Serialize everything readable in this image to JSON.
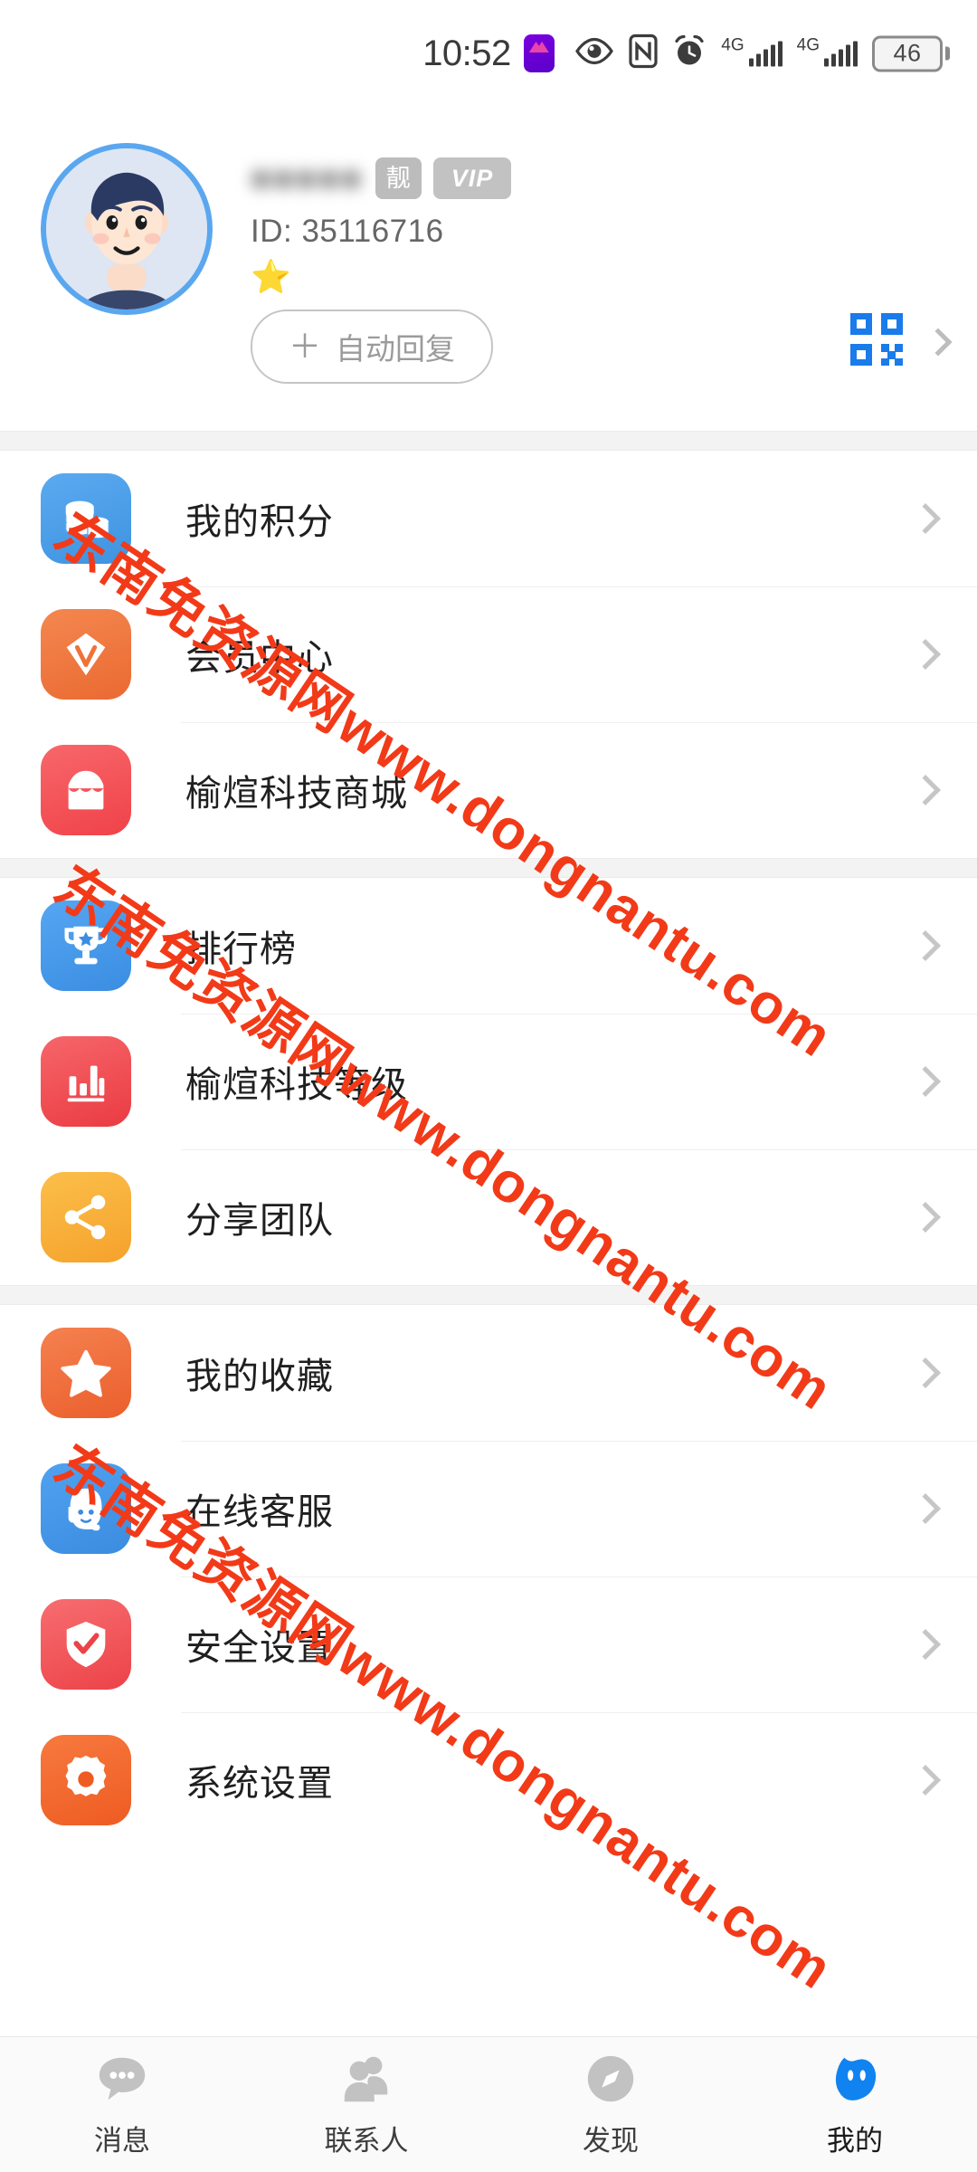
{
  "statusbar": {
    "time": "10:52",
    "app_icon": "app-notification-icon",
    "icons": [
      "eye-icon",
      "nfc-icon",
      "alarm-clock-icon"
    ],
    "signal_1_label": "4G",
    "signal_2_label": "4G",
    "battery_level": "46"
  },
  "profile": {
    "avatar": "user-avatar-cartoon",
    "nickname": "●●●●●",
    "badge_liang": "靓",
    "badge_vip": "VIP",
    "id_label": "ID: 35116716",
    "level_star": "⭐",
    "auto_reply_plus": "＋",
    "auto_reply_label": "自动回复",
    "qr_icon": "qr-code-icon",
    "chevron": "chevron-right-icon"
  },
  "menu_groups": [
    {
      "items": [
        {
          "label": "我的积分",
          "icon": "coins-icon",
          "color_start": "#5aaaf0",
          "color_end": "#3f93e0"
        },
        {
          "label": "会员中心",
          "icon": "diamond-icon",
          "color_start": "#f4874f",
          "color_end": "#ea6a32"
        },
        {
          "label": "榆煊科技商城",
          "icon": "shop-icon",
          "color_start": "#f8676b",
          "color_end": "#ef4248"
        }
      ]
    },
    {
      "items": [
        {
          "label": "排行榜",
          "icon": "trophy-icon",
          "color_start": "#55a6f2",
          "color_end": "#3b8de2"
        },
        {
          "label": "榆煊科技等级",
          "icon": "bar-chart-icon",
          "color_start": "#f6666a",
          "color_end": "#ea3b42"
        },
        {
          "label": "分享团队",
          "icon": "share-icon",
          "color_start": "#fbbf4a",
          "color_end": "#f5a22c"
        }
      ]
    },
    {
      "items": [
        {
          "label": "我的收藏",
          "icon": "star-icon",
          "color_start": "#f58150",
          "color_end": "#ea5f2c"
        },
        {
          "label": "在线客服",
          "icon": "customer-service-icon",
          "color_start": "#50a2f0",
          "color_end": "#3b8ce0"
        },
        {
          "label": "安全设置",
          "icon": "shield-check-icon",
          "color_start": "#f76d70",
          "color_end": "#ec4348"
        },
        {
          "label": "系统设置",
          "icon": "gear-icon",
          "color_start": "#f7793f",
          "color_end": "#ee5c22"
        }
      ]
    }
  ],
  "tabbar": {
    "items": [
      {
        "label": "消息",
        "icon": "chat-bubble-icon",
        "active": false
      },
      {
        "label": "联系人",
        "icon": "contacts-icon",
        "active": false
      },
      {
        "label": "发现",
        "icon": "compass-icon",
        "active": false
      },
      {
        "label": "我的",
        "icon": "profile-icon",
        "active": true
      }
    ],
    "active_color": "#1083f0",
    "inactive_color": "#c2c2c2"
  },
  "watermark": {
    "text": "东南免资源网www.dongnantu.com",
    "color": "#f23a18"
  }
}
